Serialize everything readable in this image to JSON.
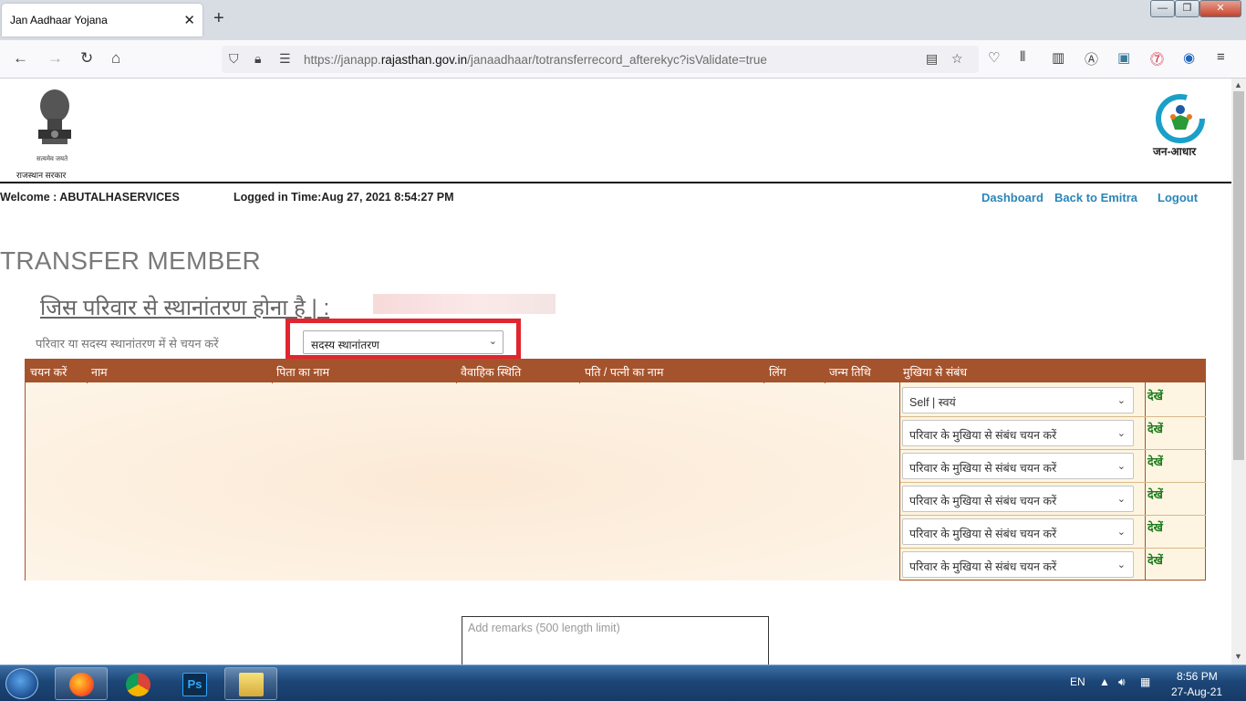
{
  "browser": {
    "tab_title": "Jan Aadhaar Yojana",
    "tab_close": "✕",
    "new_tab": "+",
    "url_prefix": "https://janapp.",
    "url_domain": "rajasthan.gov.in",
    "url_path": "/janaadhaar/totransferrecord_afterekyc?isValidate=true",
    "win_min": "—",
    "win_max": "❐",
    "win_close": "✕"
  },
  "header": {
    "emblem_motto": "सत्यमेव जयते",
    "govt_name": "राजस्थान सरकार",
    "logo_text": "जन-आधार",
    "welcome": "Welcome : ABUTALHASERVICES",
    "logged_in": "Logged in Time:Aug 27, 2021 8:54:27 PM",
    "links": {
      "dashboard": "Dashboard",
      "back": "Back to Emitra",
      "logout": "Logout"
    }
  },
  "main": {
    "title": "TRANSFER MEMBER",
    "family_label": "जिस परिवार से स्थानांतरण होना है | :",
    "select_label": "परिवार या सदस्य स्थानांतरण में से चयन करें",
    "transfer_type": "सदस्य स्थानांतरण",
    "table": {
      "headers": [
        "चयन करें",
        "नाम",
        "पिता का नाम",
        "वैवाहिक स्थिति",
        "पति / पत्नी का नाम",
        "लिंग",
        "जन्म तिथि",
        "मुखिया से संबंध"
      ],
      "rows": [
        {
          "relation": "Self | स्वयं",
          "view": "देखें"
        },
        {
          "relation": "परिवार के मुखिया से संबंध चयन करें",
          "view": "देखें"
        },
        {
          "relation": "परिवार के मुखिया से संबंध चयन करें",
          "view": "देखें"
        },
        {
          "relation": "परिवार के मुखिया से संबंध चयन करें",
          "view": "देखें"
        },
        {
          "relation": "परिवार के मुखिया से संबंध चयन करें",
          "view": "देखें"
        },
        {
          "relation": "परिवार के मुखिया से संबंध चयन करें",
          "view": "देखें"
        }
      ]
    },
    "remarks_placeholder": "Add remarks (500 length limit)"
  },
  "taskbar": {
    "lang": "EN",
    "time": "8:56 PM",
    "date": "27-Aug-21"
  },
  "colors": {
    "table_header": "#a5532c",
    "table_body": "#fdf5e1",
    "link": "#2a86b8",
    "view_link": "#1a7a1a",
    "highlight": "#e1252f"
  }
}
